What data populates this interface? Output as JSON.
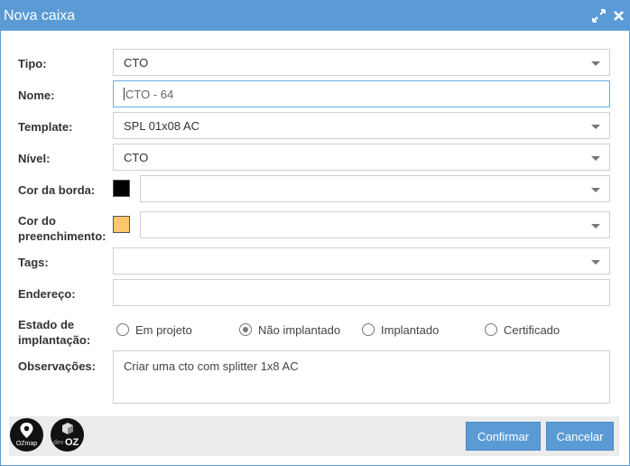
{
  "dialog": {
    "title": "Nova caixa",
    "icons": {
      "expand": "expand-icon",
      "close": "close-icon"
    }
  },
  "form": {
    "tipo": {
      "label": "Tipo:",
      "value": "CTO"
    },
    "nome": {
      "label": "Nome:",
      "value": "CTO - 64"
    },
    "template": {
      "label": "Template:",
      "value": "SPL 01x08 AC"
    },
    "nivel": {
      "label": "Nível:",
      "value": "CTO"
    },
    "cor_borda": {
      "label": "Cor da borda:",
      "color": "#000000",
      "value": ""
    },
    "cor_preenchimento": {
      "label_line1": "Cor do",
      "label_line2": "preenchimento:",
      "color": "#ffc66b",
      "value": ""
    },
    "tags": {
      "label": "Tags:",
      "value": ""
    },
    "endereco": {
      "label": "Endereço:",
      "value": ""
    },
    "estado": {
      "label_line1": "Estado de",
      "label_line2": "implantação:",
      "options": [
        "Em projeto",
        "Não implantado",
        "Implantado",
        "Certificado"
      ],
      "selected": "Não implantado"
    },
    "observacoes": {
      "label": "Observações:",
      "value": "Criar uma cto com splitter 1x8 AC"
    }
  },
  "footer": {
    "logo1_text": "OZmap",
    "logo2_text_a": "dev",
    "logo2_text_b": "OZ",
    "confirm_label": "Confirmar",
    "cancel_label": "Cancelar"
  },
  "colors": {
    "accent": "#5b9bd5"
  }
}
